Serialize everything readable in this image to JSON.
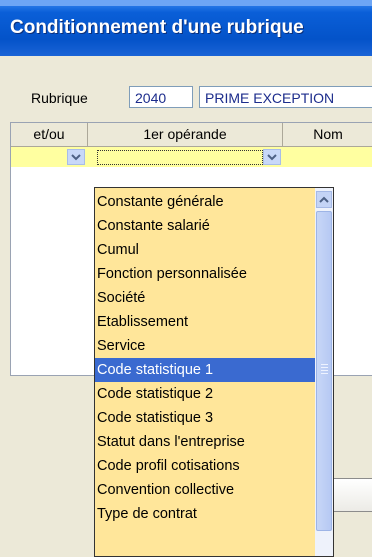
{
  "window": {
    "title": "Conditionnement d'une rubrique"
  },
  "rubrique": {
    "label": "Rubrique",
    "code": "2040",
    "name": "PRIME EXCEPTION"
  },
  "grid": {
    "columns": [
      "et/ou",
      "1er opérande",
      "Nom"
    ]
  },
  "dropdown": {
    "items": [
      "Constante générale",
      "Constante salarié",
      "Cumul",
      "Fonction personnalisée",
      "Société",
      "Etablissement",
      "Service",
      "Code statistique 1",
      "Code statistique 2",
      "Code statistique 3",
      "Statut dans l'entreprise",
      "Code profil cotisations",
      "Convention collective",
      "Type de contrat"
    ],
    "selected": "Code statistique 1"
  },
  "colors": {
    "row_highlight": "#ffffa0",
    "list_bg": "#ffe69a",
    "selection": "#3a6ad0",
    "title_bar": "#0453c9"
  },
  "icons": [
    "chevron-down-icon",
    "chevron-up-icon",
    "scroll-grip-icon"
  ]
}
